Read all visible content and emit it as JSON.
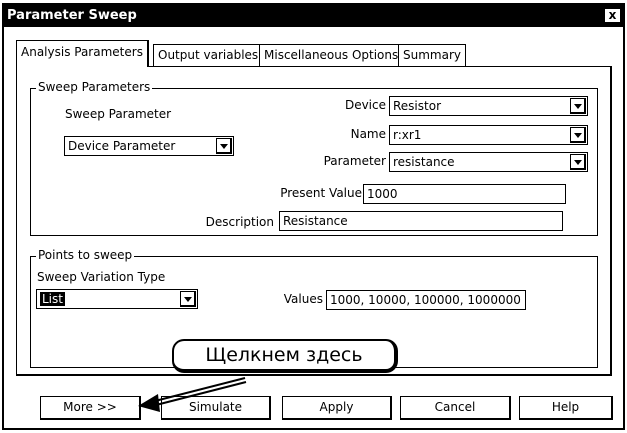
{
  "window": {
    "title": "Parameter Sweep",
    "close_glyph": "x"
  },
  "tabs": [
    {
      "label": "Analysis Parameters",
      "active": true
    },
    {
      "label": "Output variables",
      "active": false
    },
    {
      "label": "Miscellaneous Options",
      "active": false
    },
    {
      "label": "Summary",
      "active": false
    }
  ],
  "sweep_parameters": {
    "legend": "Sweep Parameters",
    "sweep_parameter_label": "Sweep Parameter",
    "sweep_parameter_value": "Device Parameter",
    "device_label": "Device",
    "device_value": "Resistor",
    "name_label": "Name",
    "name_value": "r:xr1",
    "parameter_label": "Parameter",
    "parameter_value": "resistance",
    "present_value_label": "Present Value",
    "present_value": "1000",
    "description_label": "Description",
    "description_value": "Resistance"
  },
  "points_to_sweep": {
    "legend": "Points to sweep",
    "variation_type_label": "Sweep Variation Type",
    "variation_type_value": "List",
    "values_label": "Values",
    "values_value": "1000, 10000, 100000, 1000000"
  },
  "callout": {
    "text": "Щелкнем здесь"
  },
  "buttons": {
    "more": "More >>",
    "simulate": "Simulate",
    "apply": "Apply",
    "cancel": "Cancel",
    "help": "Help"
  },
  "icons": {
    "dropdown": "chevron-down-icon",
    "close": "close-icon",
    "pointer": "arrow-pointer-icon"
  }
}
